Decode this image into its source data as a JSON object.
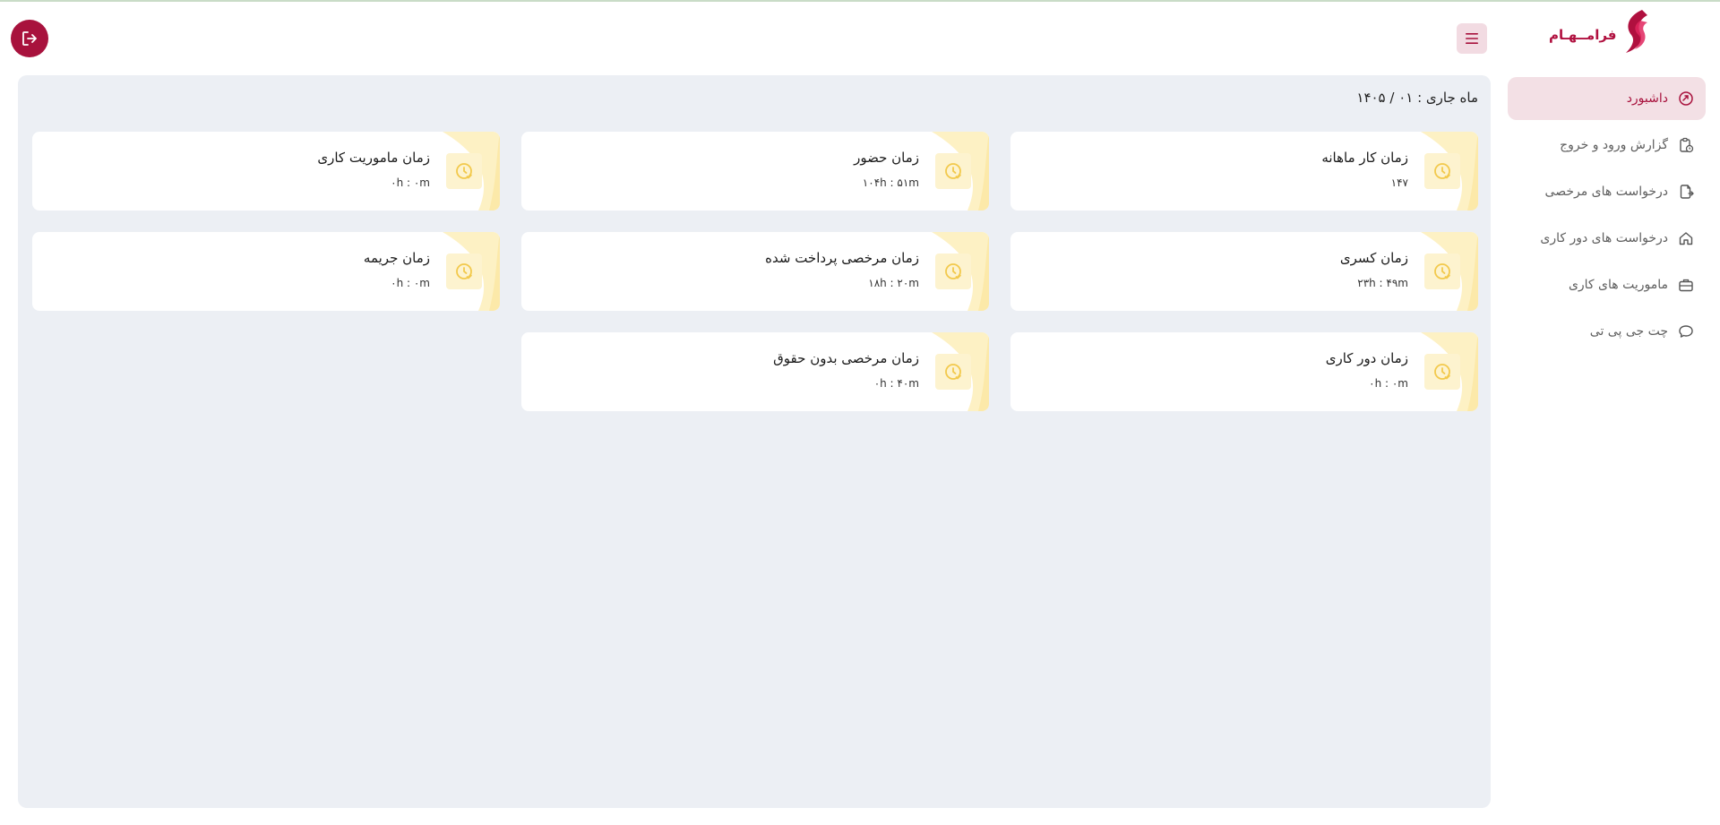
{
  "brand": {
    "name": "فرامــهـام",
    "color": "#b0103f"
  },
  "header": {
    "menu_icon": "hamburger-icon",
    "logout_icon": "logout-icon"
  },
  "sidebar": {
    "items": [
      {
        "label": "داشبورد",
        "icon": "dashboard-icon",
        "active": true
      },
      {
        "label": "گزارش ورود و خروج",
        "icon": "clipboard-clock-icon",
        "active": false
      },
      {
        "label": "درخواست های مرخصی",
        "icon": "file-export-icon",
        "active": false
      },
      {
        "label": "درخواست های دور کاری",
        "icon": "home-icon",
        "active": false
      },
      {
        "label": "ماموریت های کاری",
        "icon": "briefcase-icon",
        "active": false
      },
      {
        "label": "چت جی پی تی",
        "icon": "chat-icon",
        "active": false
      }
    ]
  },
  "main": {
    "month_label": "ماه جاری : ۰۱ / ۱۴۰۵",
    "cards": [
      {
        "title": "زمان کار ماهانه",
        "value": "۱۴۷"
      },
      {
        "title": "زمان حضور",
        "value": "۱۰۴h : ۵۱m"
      },
      {
        "title": "زمان ماموریت کاری",
        "value": "۰h : ۰m"
      },
      {
        "title": "زمان کسری",
        "value": "۲۳h : ۴۹m"
      },
      {
        "title": "زمان مرخصی پرداخت شده",
        "value": "۱۸h : ۲۰m"
      },
      {
        "title": "زمان جریمه",
        "value": "۰h : ۰m"
      },
      {
        "title": "زمان دور کاری",
        "value": "۰h : ۰m"
      },
      {
        "title": "زمان مرخصی بدون حقوق",
        "value": "۰h : ۴۰m"
      }
    ]
  },
  "colors": {
    "accent": "#a8123d",
    "panel": "#eceff4",
    "card_icon_bg": "#fdf3cf",
    "card_icon": "#f2c94c"
  }
}
